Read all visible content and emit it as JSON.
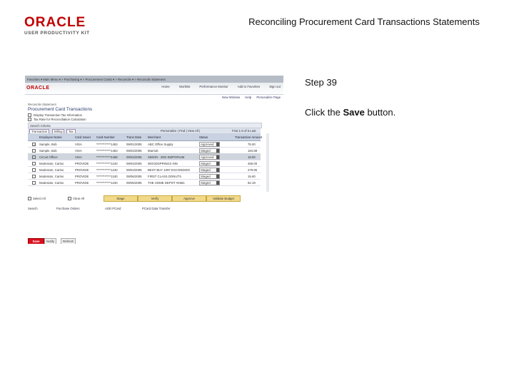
{
  "slide": {
    "logo_brand": "ORACLE",
    "logo_sub": "USER PRODUCTIVITY KIT",
    "title": "Reconciling Procurement Card Transactions Statements",
    "step": "Step 39",
    "instruction_pre": "Click the ",
    "instruction_bold": "Save",
    "instruction_post": " button."
  },
  "app": {
    "breadcrumb": "Favorites  ▾  Main Menu  ▾  > Purchasing  ▾  > Procurement Cards  ▾  > Reconcile  ▾  > Reconcile Statement",
    "logo": "ORACLE",
    "top_links": [
      "Home",
      "Worklist",
      "Performance Monitor",
      "Add to Favorites",
      "Sign out"
    ],
    "sub_links": [
      "New Window",
      "Help",
      "Personalize Page"
    ],
    "my_component": "Reconcile Statement",
    "page_title": "Procurement Card Transactions",
    "options": [
      "Display Transaction Tax Information",
      "Tax Rate for Reconciliation Calculation"
    ],
    "filter_label": "Search Criteria",
    "tabs": [
      "Transaction",
      "Billing",
      "Tax"
    ],
    "grid_nav": "Personalize | Find | View All | ",
    "grid_nav_right": "First  1-6 of 6  Last",
    "columns": [
      "Employee Name",
      "Card Issuer",
      "Card Number",
      "Trans Date",
      "Merchant",
      "Status",
      "Transaction Amount"
    ],
    "rows": [
      {
        "name": "Sample, Bob",
        "issuer": "VISA",
        "card": "************1453",
        "date": "09/01/2005",
        "merchant": "ABC Office Supply",
        "status": "Approved",
        "amount": "75.00",
        "checked": true,
        "highlight": false
      },
      {
        "name": "Sample, Bob",
        "issuer": "VISA",
        "card": "************1453",
        "date": "09/02/2005",
        "merchant": "Marriott",
        "status": "Staged",
        "amount": "184.88",
        "checked": false,
        "highlight": false
      },
      {
        "name": "Circuit Officer",
        "issuer": "VISA",
        "card": "************4458",
        "date": "09/04/2005",
        "merchant": "SIMON - 2ND EMPORIUM",
        "status": "Approved",
        "amount": "18.90",
        "checked": false,
        "highlight": true
      },
      {
        "name": "Moderator, Carlos",
        "issuer": "PROVIDE",
        "card": "************1240",
        "date": "09/04/2005",
        "merchant": "WOODSPRINGS INN",
        "status": "Staged",
        "amount": "465.00",
        "checked": false,
        "highlight": false
      },
      {
        "name": "Moderator, Carlos",
        "issuer": "PROVIDE",
        "card": "************1240",
        "date": "09/04/2005",
        "merchant": "BEST BUY 1097 ESCONDIDO",
        "status": "Staged",
        "amount": "279.95",
        "checked": false,
        "highlight": false
      },
      {
        "name": "Moderator, Carlos",
        "issuer": "PROVIDE",
        "card": "************1240",
        "date": "09/06/2005",
        "merchant": "FIRST CLASS DONUTS",
        "status": "Staged",
        "amount": "15.60",
        "checked": false,
        "highlight": false
      },
      {
        "name": "Moderator, Carlos",
        "issuer": "PROVIDE",
        "card": "************1240",
        "date": "09/06/2005",
        "merchant": "THE HOME DEPOT #4581",
        "status": "Staged",
        "amount": "82.19",
        "checked": false,
        "highlight": false
      }
    ],
    "select_all": "Select All",
    "clear_all": "Clear All",
    "buttons": [
      "Stage",
      "Verify",
      "Approve",
      "Validate Budget"
    ],
    "bottom_links": [
      "Search",
      "Purchase Orders",
      "ADD PCard",
      "PCard Data Transfer"
    ],
    "save_label": "Save",
    "action_buttons": [
      "Notify",
      "Refresh"
    ]
  }
}
